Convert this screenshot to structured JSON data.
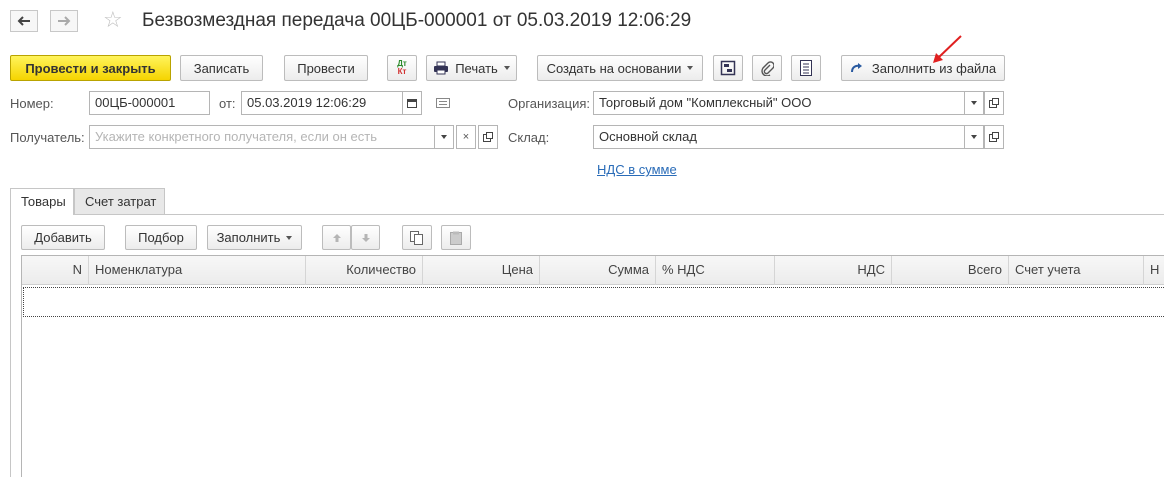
{
  "header": {
    "title": "Безвозмездная передача 00ЦБ-000001 от 05.03.2019 12:06:29"
  },
  "toolbar": {
    "post_and_close": "Провести и закрыть",
    "save": "Записать",
    "post": "Провести",
    "dt_kt_top": "Дт",
    "dt_kt_bottom": "Кт",
    "print": "Печать",
    "create_based_on": "Создать на основании",
    "fill_from_file": "Заполнить из файла"
  },
  "form": {
    "number_label": "Номер:",
    "number_value": "00ЦБ-000001",
    "date_label": "от:",
    "date_value": "05.03.2019 12:06:29",
    "organization_label": "Организация:",
    "organization_value": "Торговый дом \"Комплексный\" ООО",
    "recipient_label": "Получатель:",
    "recipient_placeholder": "Укажите конкретного получателя, если он есть",
    "warehouse_label": "Склад:",
    "warehouse_value": "Основной склад",
    "vat_link": "НДС в сумме"
  },
  "tabs": [
    {
      "label": "Товары",
      "active": true
    },
    {
      "label": "Счет затрат",
      "active": false
    }
  ],
  "table_toolbar": {
    "add": "Добавить",
    "selection": "Подбор",
    "fill": "Заполнить"
  },
  "table": {
    "columns": [
      "N",
      "Номенклатура",
      "Количество",
      "Цена",
      "Сумма",
      "% НДС",
      "НДС",
      "Всего",
      "Счет учета",
      "Н"
    ],
    "rows": []
  },
  "colors": {
    "primary_button": "#f5d400",
    "link": "#2a6cb8",
    "annotation_arrow": "#e02020"
  }
}
